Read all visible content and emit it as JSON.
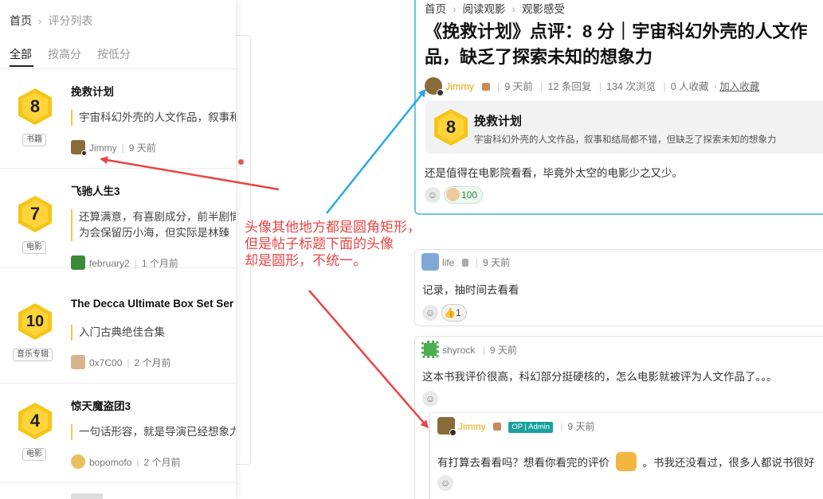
{
  "left": {
    "breadcrumb": [
      "首页",
      "评分列表"
    ],
    "tabs": [
      "全部",
      "按高分",
      "按低分"
    ],
    "items": [
      {
        "score": "8",
        "tag": "书籍",
        "title": "挽救计划",
        "quote": "宇宙科幻外壳的人文作品，叙事和结局都不错，但缺乏了探索未知的想象力",
        "user": "Jimmy",
        "time": "9 天前"
      },
      {
        "score": "7",
        "tag": "电影",
        "title": "飞驰人生3",
        "quote": "还算满意，有喜剧成分，前半剧情",
        "quote2": "为会保留历小海，但实际是林臻",
        "user": "february2",
        "time": "1 个月前"
      },
      {
        "score": "10",
        "tag": "音乐专辑",
        "title": "The Decca Ultimate Box Set Series",
        "quote": "入门古典绝佳合集",
        "user": "0x7C00",
        "time": "2 个月前"
      },
      {
        "score": "4",
        "tag": "电影",
        "title": "惊天魔盗团3",
        "quote": "一句话形容，就是导演已经想象力",
        "user": "bopomofo",
        "time": "2 个月前"
      }
    ]
  },
  "post": {
    "breadcrumb": [
      "首页",
      "阅读观影",
      "观影感受"
    ],
    "title": "《挽救计划》点评：8 分｜宇宙科幻外壳的人文作品，缺乏了探索未知的想象力",
    "author": "Jimmy",
    "time": "9 天前",
    "replies": "12 条回复",
    "views": "134 次浏览",
    "saves": "0 人收藏",
    "save_link": "加入收藏",
    "embed": {
      "score": "8",
      "title": "挽救计划",
      "sub": "宇宙科幻外壳的人文作品，叙事和结局都不错，但缺乏了探索未知的想象力"
    },
    "body": "还是值得在电影院看看，毕竟外太空的电影少之又少。",
    "reaction_count": "100"
  },
  "comments": [
    {
      "user": "life",
      "time": "9 天前",
      "body": "记录，抽时间去看看",
      "reaction": "1"
    },
    {
      "user": "shyrock",
      "time": "9 天前",
      "body": "这本书我评价很高，科幻部分挺硬核的，怎么电影就被评为人文作品了。。。"
    }
  ],
  "reply": {
    "user": "Jimmy",
    "badge": "OP | Admin",
    "time": "9 天前",
    "body_a": "有打算去看看吗？想看你看完的评价",
    "body_b": "。书我还没看过，很多人都说书很好"
  },
  "annotation": [
    "头像其他地方都是圆角矩形，",
    "但是帖子标题下面的头像",
    "却是圆形，不统一。"
  ],
  "colors": {
    "accent_yellow": "#ffd43b",
    "annotation_red": "#e84545",
    "arrow_blue": "#29a8e8",
    "post_border": "#6ec6e0"
  }
}
